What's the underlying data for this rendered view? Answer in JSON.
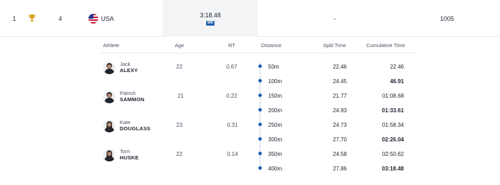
{
  "summary": {
    "rank": "1",
    "medal_icon": "trophy-icon",
    "medal_color": "#d4a017",
    "lane": "4",
    "country_flag_icon": "usa-flag-icon",
    "country": "USA",
    "time": "3:18.48",
    "record_badge": "WR",
    "behind": "-",
    "points": "1005"
  },
  "columns": {
    "athlete": "Athlete",
    "age": "Age",
    "rt": "RT",
    "distance": "Distance",
    "split_time": "Split Time",
    "cumulative_time": "Cumulative Time"
  },
  "athletes": [
    {
      "first": "Jack",
      "last": "ALEXY",
      "age": "22",
      "rt": "0.67",
      "avatar_icon": "athlete-avatar-icon"
    },
    {
      "first": "Patrick",
      "last": "SAMMON",
      "age": "21",
      "rt": "0.22",
      "avatar_icon": "athlete-avatar-icon"
    },
    {
      "first": "Kate",
      "last": "DOUGLASS",
      "age": "23",
      "rt": "0.31",
      "avatar_icon": "athlete-avatar-icon"
    },
    {
      "first": "Torri",
      "last": "HUSKE",
      "age": "22",
      "rt": "0.14",
      "avatar_icon": "athlete-avatar-icon"
    }
  ],
  "splits": [
    {
      "distance": "50m",
      "split": "22.46",
      "cumulative": "22.46"
    },
    {
      "distance": "100m",
      "split": "24.45",
      "cumulative": "46.91"
    },
    {
      "distance": "150m",
      "split": "21.77",
      "cumulative": "01:08.68"
    },
    {
      "distance": "200m",
      "split": "24.93",
      "cumulative": "01:33.61"
    },
    {
      "distance": "250m",
      "split": "24.73",
      "cumulative": "01:58.34"
    },
    {
      "distance": "300m",
      "split": "27.70",
      "cumulative": "02:26.04"
    },
    {
      "distance": "350m",
      "split": "24.58",
      "cumulative": "02:50.62"
    },
    {
      "distance": "400m",
      "split": "27.86",
      "cumulative": "03:18.48"
    }
  ],
  "colors": {
    "accent": "#1f5fb0",
    "timeline": "#c7d3e3",
    "highlight_cell": "#f3f4f6"
  }
}
